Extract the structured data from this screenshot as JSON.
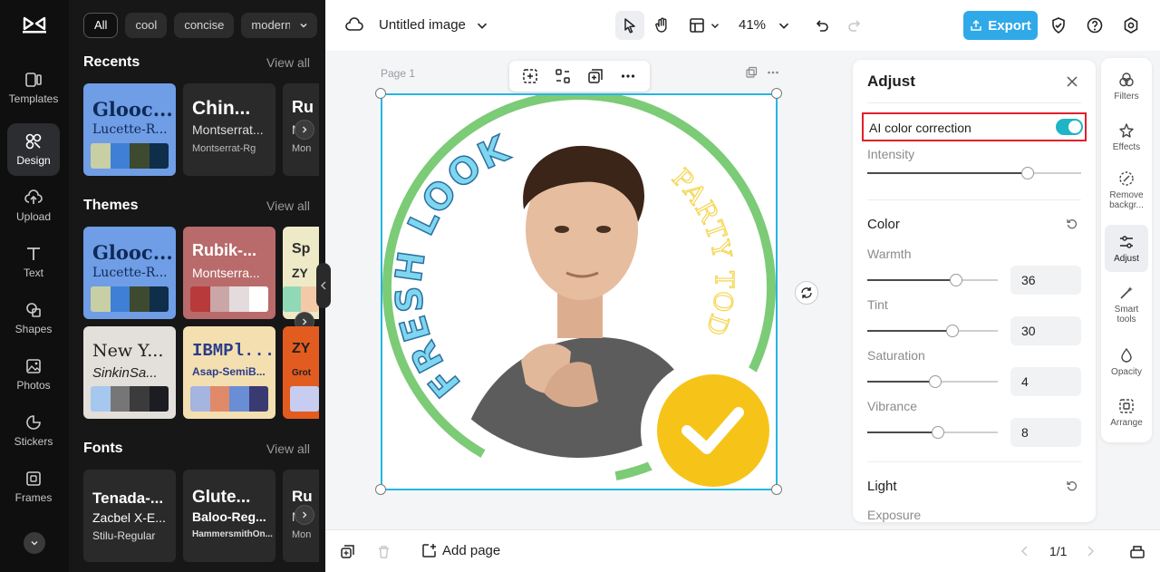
{
  "rail": {
    "items": [
      {
        "label": "Templates",
        "icon": "templates-icon"
      },
      {
        "label": "Design",
        "icon": "design-icon"
      },
      {
        "label": "Upload",
        "icon": "upload-icon"
      },
      {
        "label": "Text",
        "icon": "text-icon"
      },
      {
        "label": "Shapes",
        "icon": "shapes-icon"
      },
      {
        "label": "Photos",
        "icon": "photos-icon"
      },
      {
        "label": "Stickers",
        "icon": "stickers-icon"
      },
      {
        "label": "Frames",
        "icon": "frames-icon"
      }
    ]
  },
  "panel": {
    "chips": [
      "All",
      "cool",
      "concise",
      "modern"
    ],
    "recents": {
      "title": "Recents",
      "view_all": "View all",
      "cards": [
        {
          "t1": "Glooc...",
          "t2": "Lucette-R...",
          "colors": [
            "#c9cfa4",
            "#3f7fd6",
            "#3d4a2f",
            "#0f2e4a"
          ],
          "bg": "#6f9de6",
          "fg": "#0e2a55"
        },
        {
          "t1": "Chin...",
          "t2": "Montserrat...",
          "t3": "Montserrat-Rg",
          "bg": "#2a2a2a",
          "fg": "#ffffff"
        },
        {
          "t1": "Ru",
          "t2": "M",
          "t3": "Mon",
          "bg": "#2a2a2a",
          "fg": "#ffffff"
        }
      ]
    },
    "themes": {
      "title": "Themes",
      "view_all": "View all",
      "cards": [
        {
          "t1": "Glooc...",
          "t2": "Lucette-R...",
          "colors": [
            "#c9cfa4",
            "#3f7fd6",
            "#3d4a2f",
            "#0f2e4a"
          ],
          "bg": "#6f9de6",
          "fg": "#0e2a55"
        },
        {
          "t1": "Rubik-...",
          "t2": "Montserra...",
          "colors": [
            "#b83a3a",
            "#caa6a6",
            "#e4dcdc",
            "#ffffff"
          ],
          "bg": "#b96a6a",
          "fg": "#ffffff"
        },
        {
          "t1": "Sp",
          "t2": "ZY",
          "colors": [
            "#8fd9b6",
            "#f4c9a8"
          ],
          "bg": "#eeeac8",
          "fg": "#2d2d2d"
        },
        {
          "t1": "New Y...",
          "t2": "SinkinSa...",
          "colors": [
            "#a6c7ee",
            "#767676",
            "#3b3b3b",
            "#1b1d22"
          ],
          "bg": "#e3dfda",
          "fg": "#1f1f1f"
        },
        {
          "t1": "IBMPl...",
          "t2": "Asap-SemiB...",
          "colors": [
            "#a6b4e0",
            "#e08a6a",
            "#6a8ed6",
            "#3a3a72"
          ],
          "bg": "#f3dfb0",
          "fg": "#2b3d8a"
        },
        {
          "t1": "ZY",
          "t2": "Grot",
          "colors": [
            "#c7cdf0"
          ],
          "bg": "#e35c1f",
          "fg": "#1f1f1f"
        }
      ]
    },
    "fonts": {
      "title": "Fonts",
      "view_all": "View all",
      "cards": [
        {
          "t1": "Tenada-...",
          "t2": "Zacbel X-E...",
          "t3": "Stilu-Regular",
          "bg": "#2a2a2a",
          "fg": "#ffffff"
        },
        {
          "t1": "Glute...",
          "t2": "Baloo-Reg...",
          "t3": "HammersmithOn...",
          "bg": "#2a2a2a",
          "fg": "#ffffff"
        },
        {
          "t1": "Ru",
          "t2": "M",
          "t3": "Mon",
          "bg": "#2a2a2a",
          "fg": "#ffffff"
        }
      ]
    }
  },
  "topbar": {
    "title": "Untitled image",
    "zoom": "41%",
    "export": "Export"
  },
  "canvas": {
    "page_label": "Page 1",
    "text_left": "FRESH LOOK",
    "text_right": "PARTY TODAY"
  },
  "adjust": {
    "title": "Adjust",
    "ai_label": "AI color correction",
    "ai_enabled": true,
    "intensity": {
      "label": "Intensity",
      "level": 0.75
    },
    "color_title": "Color",
    "sliders": [
      {
        "label": "Warmth",
        "value": "36",
        "level": 0.68
      },
      {
        "label": "Tint",
        "value": "30",
        "level": 0.65
      },
      {
        "label": "Saturation",
        "value": "4",
        "level": 0.52
      },
      {
        "label": "Vibrance",
        "value": "8",
        "level": 0.54
      }
    ],
    "light_title": "Light",
    "exposure_label": "Exposure"
  },
  "rtools": [
    {
      "label": "Filters",
      "icon": "filters-icon"
    },
    {
      "label": "Effects",
      "icon": "effects-icon"
    },
    {
      "label": "Remove backgr...",
      "icon": "remove-background-icon"
    },
    {
      "label": "Adjust",
      "icon": "adjust-icon"
    },
    {
      "label": "Smart tools",
      "icon": "smart-tools-icon"
    },
    {
      "label": "Opacity",
      "icon": "opacity-icon"
    },
    {
      "label": "Arrange",
      "icon": "arrange-icon"
    }
  ],
  "bottombar": {
    "add_page": "Add page",
    "pager": "1/1"
  },
  "colors": {
    "accent": "#2fa9e8",
    "toggle": "#1fb5c6",
    "highlight": "#e0202a",
    "ring": "#7ccb76",
    "badge": "#f6c419"
  }
}
